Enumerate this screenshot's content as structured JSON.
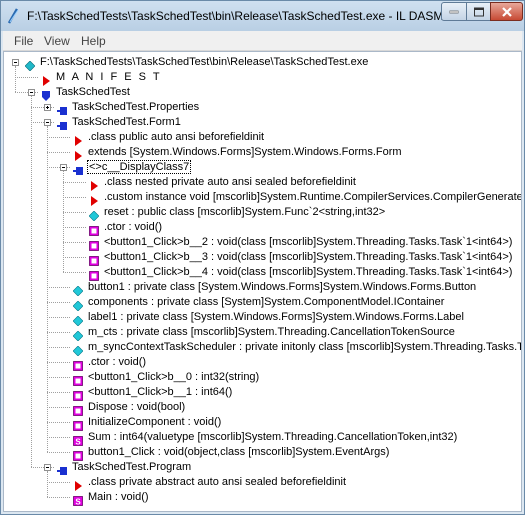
{
  "window": {
    "title": "F:\\TaskSchedTests\\TaskSchedTest\\bin\\Release\\TaskSchedTest.exe - IL DASM"
  },
  "menu": [
    "File",
    "View",
    "Help"
  ],
  "tree": [
    {
      "level": 0,
      "expander": "minus",
      "icon": "assembly-icon",
      "label": "F:\\TaskSchedTests\\TaskSchedTest\\bin\\Release\\TaskSchedTest.exe"
    },
    {
      "level": 1,
      "expander": "none",
      "icon": "manifest-icon",
      "label": "M A N I F E S T"
    },
    {
      "level": 1,
      "expander": "minus",
      "icon": "namespace-icon",
      "label": "TaskSchedTest"
    },
    {
      "level": 2,
      "expander": "plus",
      "icon": "class-icon",
      "label": "TaskSchedTest.Properties"
    },
    {
      "level": 2,
      "expander": "minus",
      "icon": "class-icon",
      "label": "TaskSchedTest.Form1"
    },
    {
      "level": 3,
      "expander": "none",
      "icon": "info-icon",
      "label": ".class public auto ansi beforefieldinit"
    },
    {
      "level": 3,
      "expander": "none",
      "icon": "info-icon",
      "label": "extends [System.Windows.Forms]System.Windows.Forms.Form"
    },
    {
      "level": 3,
      "expander": "minus",
      "icon": "class-icon",
      "label": "<>c__DisplayClass7",
      "selected": true
    },
    {
      "level": 4,
      "expander": "none",
      "icon": "info-icon",
      "label": ".class nested private auto ansi sealed beforefieldinit"
    },
    {
      "level": 4,
      "expander": "none",
      "icon": "info-icon",
      "label": ".custom instance void [mscorlib]System.Runtime.CompilerServices.CompilerGeneratedAttribute"
    },
    {
      "level": 4,
      "expander": "none",
      "icon": "field-icon",
      "label": "reset : public class [mscorlib]System.Func`2<string,int32>"
    },
    {
      "level": 4,
      "expander": "none",
      "icon": "method-icon",
      "label": ".ctor : void()"
    },
    {
      "level": 4,
      "expander": "none",
      "icon": "method-icon",
      "label": "<button1_Click>b__2 : void(class [mscorlib]System.Threading.Tasks.Task`1<int64>)"
    },
    {
      "level": 4,
      "expander": "none",
      "icon": "method-icon",
      "label": "<button1_Click>b__3 : void(class [mscorlib]System.Threading.Tasks.Task`1<int64>)"
    },
    {
      "level": 4,
      "expander": "none",
      "icon": "method-icon",
      "label": "<button1_Click>b__4 : void(class [mscorlib]System.Threading.Tasks.Task`1<int64>)"
    },
    {
      "level": 3,
      "expander": "none",
      "icon": "field-icon",
      "label": "button1 : private class [System.Windows.Forms]System.Windows.Forms.Button"
    },
    {
      "level": 3,
      "expander": "none",
      "icon": "field-icon",
      "label": "components : private class [System]System.ComponentModel.IContainer"
    },
    {
      "level": 3,
      "expander": "none",
      "icon": "field-icon",
      "label": "label1 : private class [System.Windows.Forms]System.Windows.Forms.Label"
    },
    {
      "level": 3,
      "expander": "none",
      "icon": "field-icon",
      "label": "m_cts : private class [mscorlib]System.Threading.CancellationTokenSource"
    },
    {
      "level": 3,
      "expander": "none",
      "icon": "field-icon",
      "label": "m_syncContextTaskScheduler : private initonly class [mscorlib]System.Threading.Tasks.TaskScheduler"
    },
    {
      "level": 3,
      "expander": "none",
      "icon": "method-icon",
      "label": ".ctor : void()"
    },
    {
      "level": 3,
      "expander": "none",
      "icon": "method-icon",
      "label": "<button1_Click>b__0 : int32(string)"
    },
    {
      "level": 3,
      "expander": "none",
      "icon": "method-icon",
      "label": "<button1_Click>b__1 : int64()"
    },
    {
      "level": 3,
      "expander": "none",
      "icon": "method-icon",
      "label": "Dispose : void(bool)"
    },
    {
      "level": 3,
      "expander": "none",
      "icon": "method-icon",
      "label": "InitializeComponent : void()"
    },
    {
      "level": 3,
      "expander": "none",
      "icon": "static-method-icon",
      "label": "Sum : int64(valuetype [mscorlib]System.Threading.CancellationToken,int32)"
    },
    {
      "level": 3,
      "expander": "none",
      "icon": "method-icon",
      "label": "button1_Click : void(object,class [mscorlib]System.EventArgs)"
    },
    {
      "level": 2,
      "expander": "minus",
      "icon": "class-icon",
      "label": "TaskSchedTest.Program"
    },
    {
      "level": 3,
      "expander": "none",
      "icon": "info-icon",
      "label": ".class private abstract auto ansi sealed beforefieldinit"
    },
    {
      "level": 3,
      "expander": "none",
      "icon": "static-method-icon",
      "label": "Main : void()"
    }
  ],
  "colors": {
    "assembly": "#20b8c8",
    "info": "#e00000",
    "namespace": "#1a30d0",
    "class": "#1a30d0",
    "field": "#20c8d8",
    "method": "#e000e0",
    "static": "#e000e0"
  }
}
